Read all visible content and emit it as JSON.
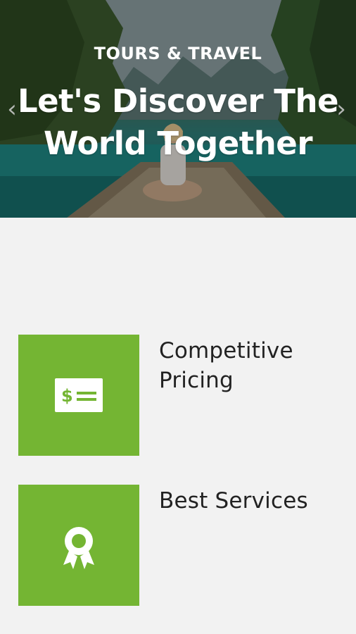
{
  "hero": {
    "kicker": "TOURS & TRAVEL",
    "title_line1": "Let's Discover The",
    "title_line2": "World Together",
    "prev_glyph": "‹",
    "next_glyph": "›"
  },
  "features": [
    {
      "icon": "price-tag-icon",
      "label_line1": "Competitive",
      "label_line2": "Pricing"
    },
    {
      "icon": "award-ribbon-icon",
      "label_line1": "Best Services",
      "label_line2": ""
    }
  ],
  "colors": {
    "accent_green": "#74b533",
    "page_background": "#f2f2f2",
    "text_dark": "#222222"
  }
}
